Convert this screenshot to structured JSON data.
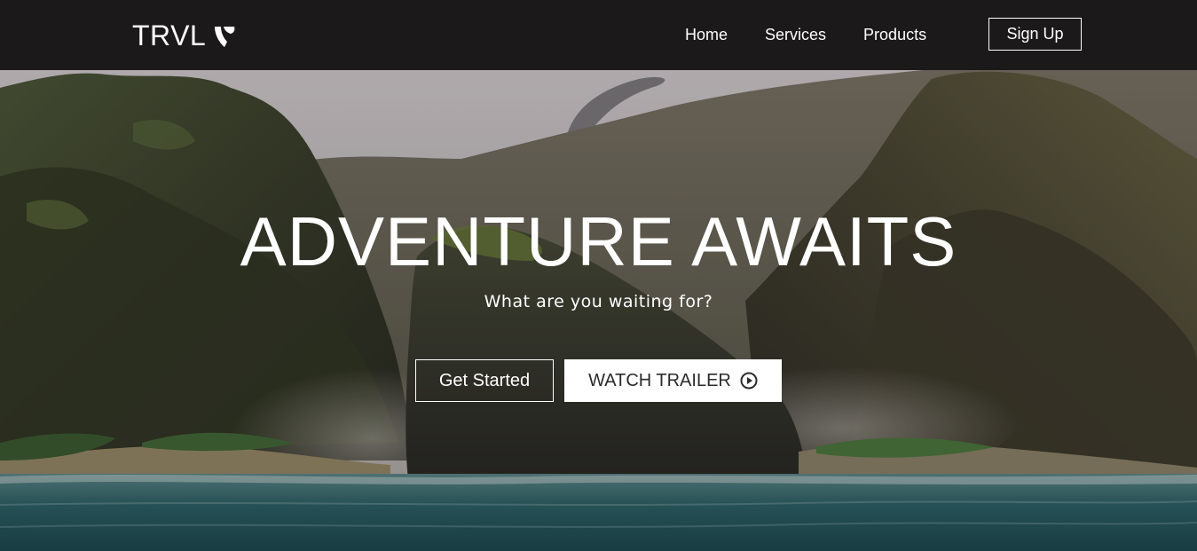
{
  "navbar": {
    "logo_text": "TRVL",
    "links": [
      {
        "label": "Home"
      },
      {
        "label": "Services"
      },
      {
        "label": "Products"
      }
    ],
    "signup_label": "Sign Up",
    "background": "#1b1919"
  },
  "hero": {
    "title": "ADVENTURE AWAITS",
    "subtitle": "What are you waiting for?",
    "primary_button": "Get Started",
    "secondary_button": "WATCH TRAILER",
    "secondary_icon": "play-circle-icon"
  }
}
